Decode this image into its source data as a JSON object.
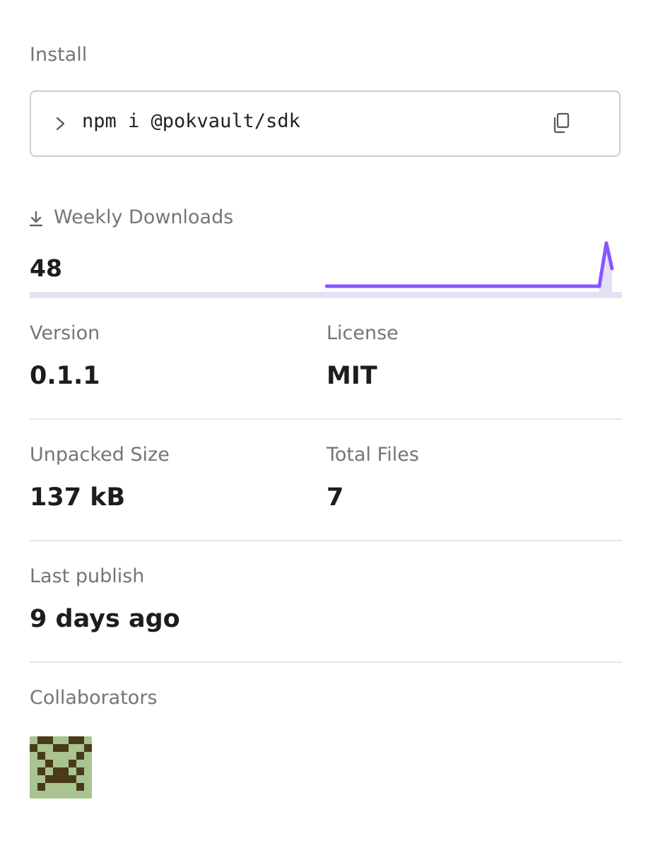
{
  "install": {
    "heading": "Install",
    "command": "npm i @pokvault/sdk",
    "icons": {
      "prompt": "prompt-chevron-icon",
      "copy": "copy-icon"
    }
  },
  "downloads": {
    "heading": "Weekly Downloads",
    "count": "48",
    "icon": "download-icon",
    "accent_color": "#8956ff",
    "fill_color": "#e4e0f5"
  },
  "stats": {
    "version": {
      "label": "Version",
      "value": "0.1.1"
    },
    "license": {
      "label": "License",
      "value": "MIT"
    },
    "unpacked_size": {
      "label": "Unpacked Size",
      "value": "137 kB"
    },
    "total_files": {
      "label": "Total Files",
      "value": "7"
    },
    "last_publish": {
      "label": "Last publish",
      "value": "9 days ago"
    }
  },
  "collaborators": {
    "heading": "Collaborators",
    "avatar_colors": {
      "dark": "#4a3a1c",
      "light": "#a9c48e"
    }
  }
}
